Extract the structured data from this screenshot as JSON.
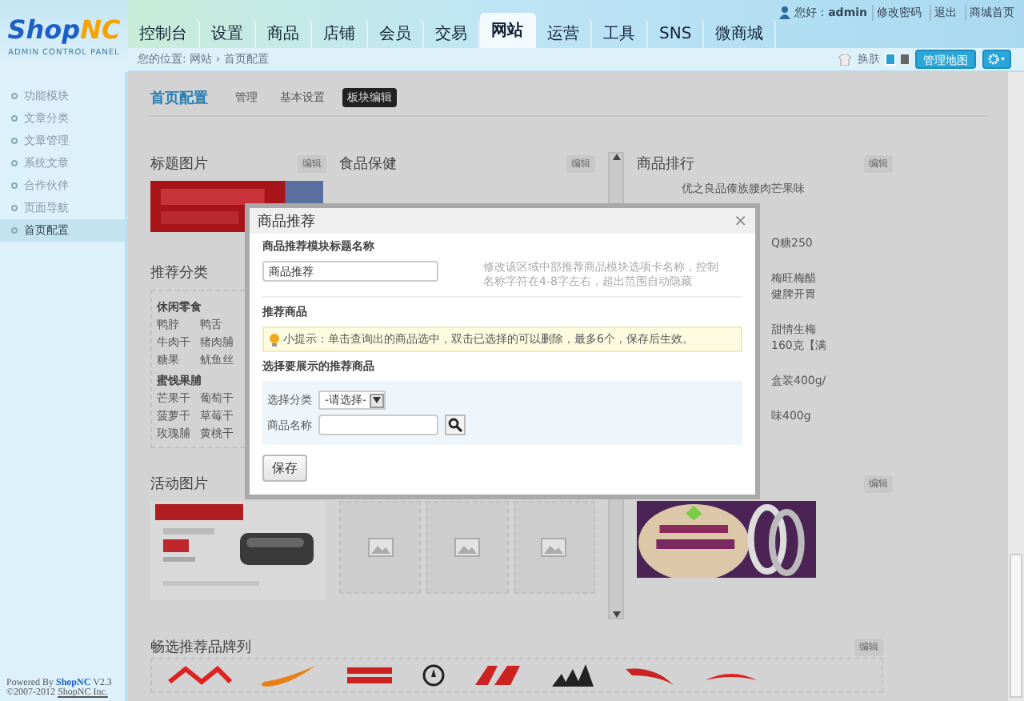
{
  "header": {
    "logo_main": "Shop",
    "logo_accent": "NC",
    "logo_subtitle": "ADMIN CONTROL PANEL"
  },
  "nav": [
    {
      "label": "控制台",
      "selected": false
    },
    {
      "label": "设置",
      "selected": false
    },
    {
      "label": "商品",
      "selected": false
    },
    {
      "label": "店铺",
      "selected": false
    },
    {
      "label": "会员",
      "selected": false
    },
    {
      "label": "交易",
      "selected": false
    },
    {
      "label": "网站",
      "selected": true
    },
    {
      "label": "运营",
      "selected": false
    },
    {
      "label": "工具",
      "selected": false
    },
    {
      "label": "SNS",
      "selected": false
    },
    {
      "label": "微商城",
      "selected": false
    }
  ],
  "user": {
    "greeting": "您好：",
    "name": "admin",
    "links": [
      "修改密码",
      "退出",
      "商城首页"
    ]
  },
  "breadcrumb": {
    "label": "您的位置:",
    "items": [
      "网站",
      "首页配置"
    ],
    "separator": "›"
  },
  "toolbar": {
    "skin_label": "换肤",
    "skins": [
      {
        "color": "#2a9fd6",
        "selected": true
      },
      {
        "color": "#666666",
        "selected": false
      }
    ],
    "map_button": "管理地图"
  },
  "sidebar": {
    "items": [
      {
        "label": "功能模块",
        "selected": false
      },
      {
        "label": "文章分类",
        "selected": false
      },
      {
        "label": "文章管理",
        "selected": false
      },
      {
        "label": "系统文章",
        "selected": false
      },
      {
        "label": "合作伙伴",
        "selected": false
      },
      {
        "label": "页面导航",
        "selected": false
      },
      {
        "label": "首页配置",
        "selected": true
      }
    ],
    "footer": {
      "powered": "Powered By",
      "brand": "ShopNC",
      "version": "V2.3",
      "copyright": "©2007-2012",
      "company": "ShopNC Inc."
    }
  },
  "page": {
    "title": "首页配置",
    "tabs": [
      {
        "label": "管理",
        "selected": false
      },
      {
        "label": "基本设置",
        "selected": false
      },
      {
        "label": "板块编辑",
        "selected": true
      }
    ]
  },
  "panels": {
    "title_image": {
      "title": "标题图片",
      "edit": "编辑"
    },
    "category": {
      "title": "推荐分类",
      "groups": [
        {
          "name": "休闲零食",
          "items": [
            [
              "鸭脖",
              "鸭舌"
            ],
            [
              "牛肉干",
              "猪肉脯"
            ],
            [
              "糖果",
              "鱿鱼丝"
            ]
          ]
        },
        {
          "name": "蜜饯果脯",
          "items": [
            [
              "芒果干",
              "葡萄干"
            ],
            [
              "菠萝干",
              "草莓干"
            ],
            [
              "玫瑰脯",
              "黄桃干"
            ]
          ]
        }
      ]
    },
    "activity": {
      "title": "活动图片"
    },
    "food": {
      "title": "食品保健",
      "edit": "编辑"
    },
    "ranking": {
      "title": "商品排行",
      "edit": "编辑",
      "first_item": "优之良品傣族腰肉芒果味",
      "items": [
        [
          "Q糖250"
        ],
        [
          "梅旺梅醋",
          "健脾开胃"
        ],
        [
          "甜情生梅",
          "160克【满"
        ],
        [
          "盒装400g/"
        ],
        [
          "味400g"
        ]
      ]
    },
    "banner": {
      "edit": "编辑"
    },
    "brands": {
      "title": "畅选推荐品牌列",
      "edit": "编辑"
    }
  },
  "dialog": {
    "title": "商品推荐",
    "close": "×",
    "name_label": "商品推荐模块标题名称",
    "name_value": "商品推荐",
    "name_hint": "修改该区域中部推荐商品模块选项卡名称，控制名称字符在4-8字左右，超出范围自动隐藏",
    "goods_label": "推荐商品",
    "tip": "小提示：单击查询出的商品选中，双击已选择的可以删除，最多6个，保存后生效。",
    "choose_label": "选择要展示的推荐商品",
    "category_label": "选择分类",
    "category_value": "-请选择-",
    "goods_name_label": "商品名称",
    "save": "保存"
  }
}
